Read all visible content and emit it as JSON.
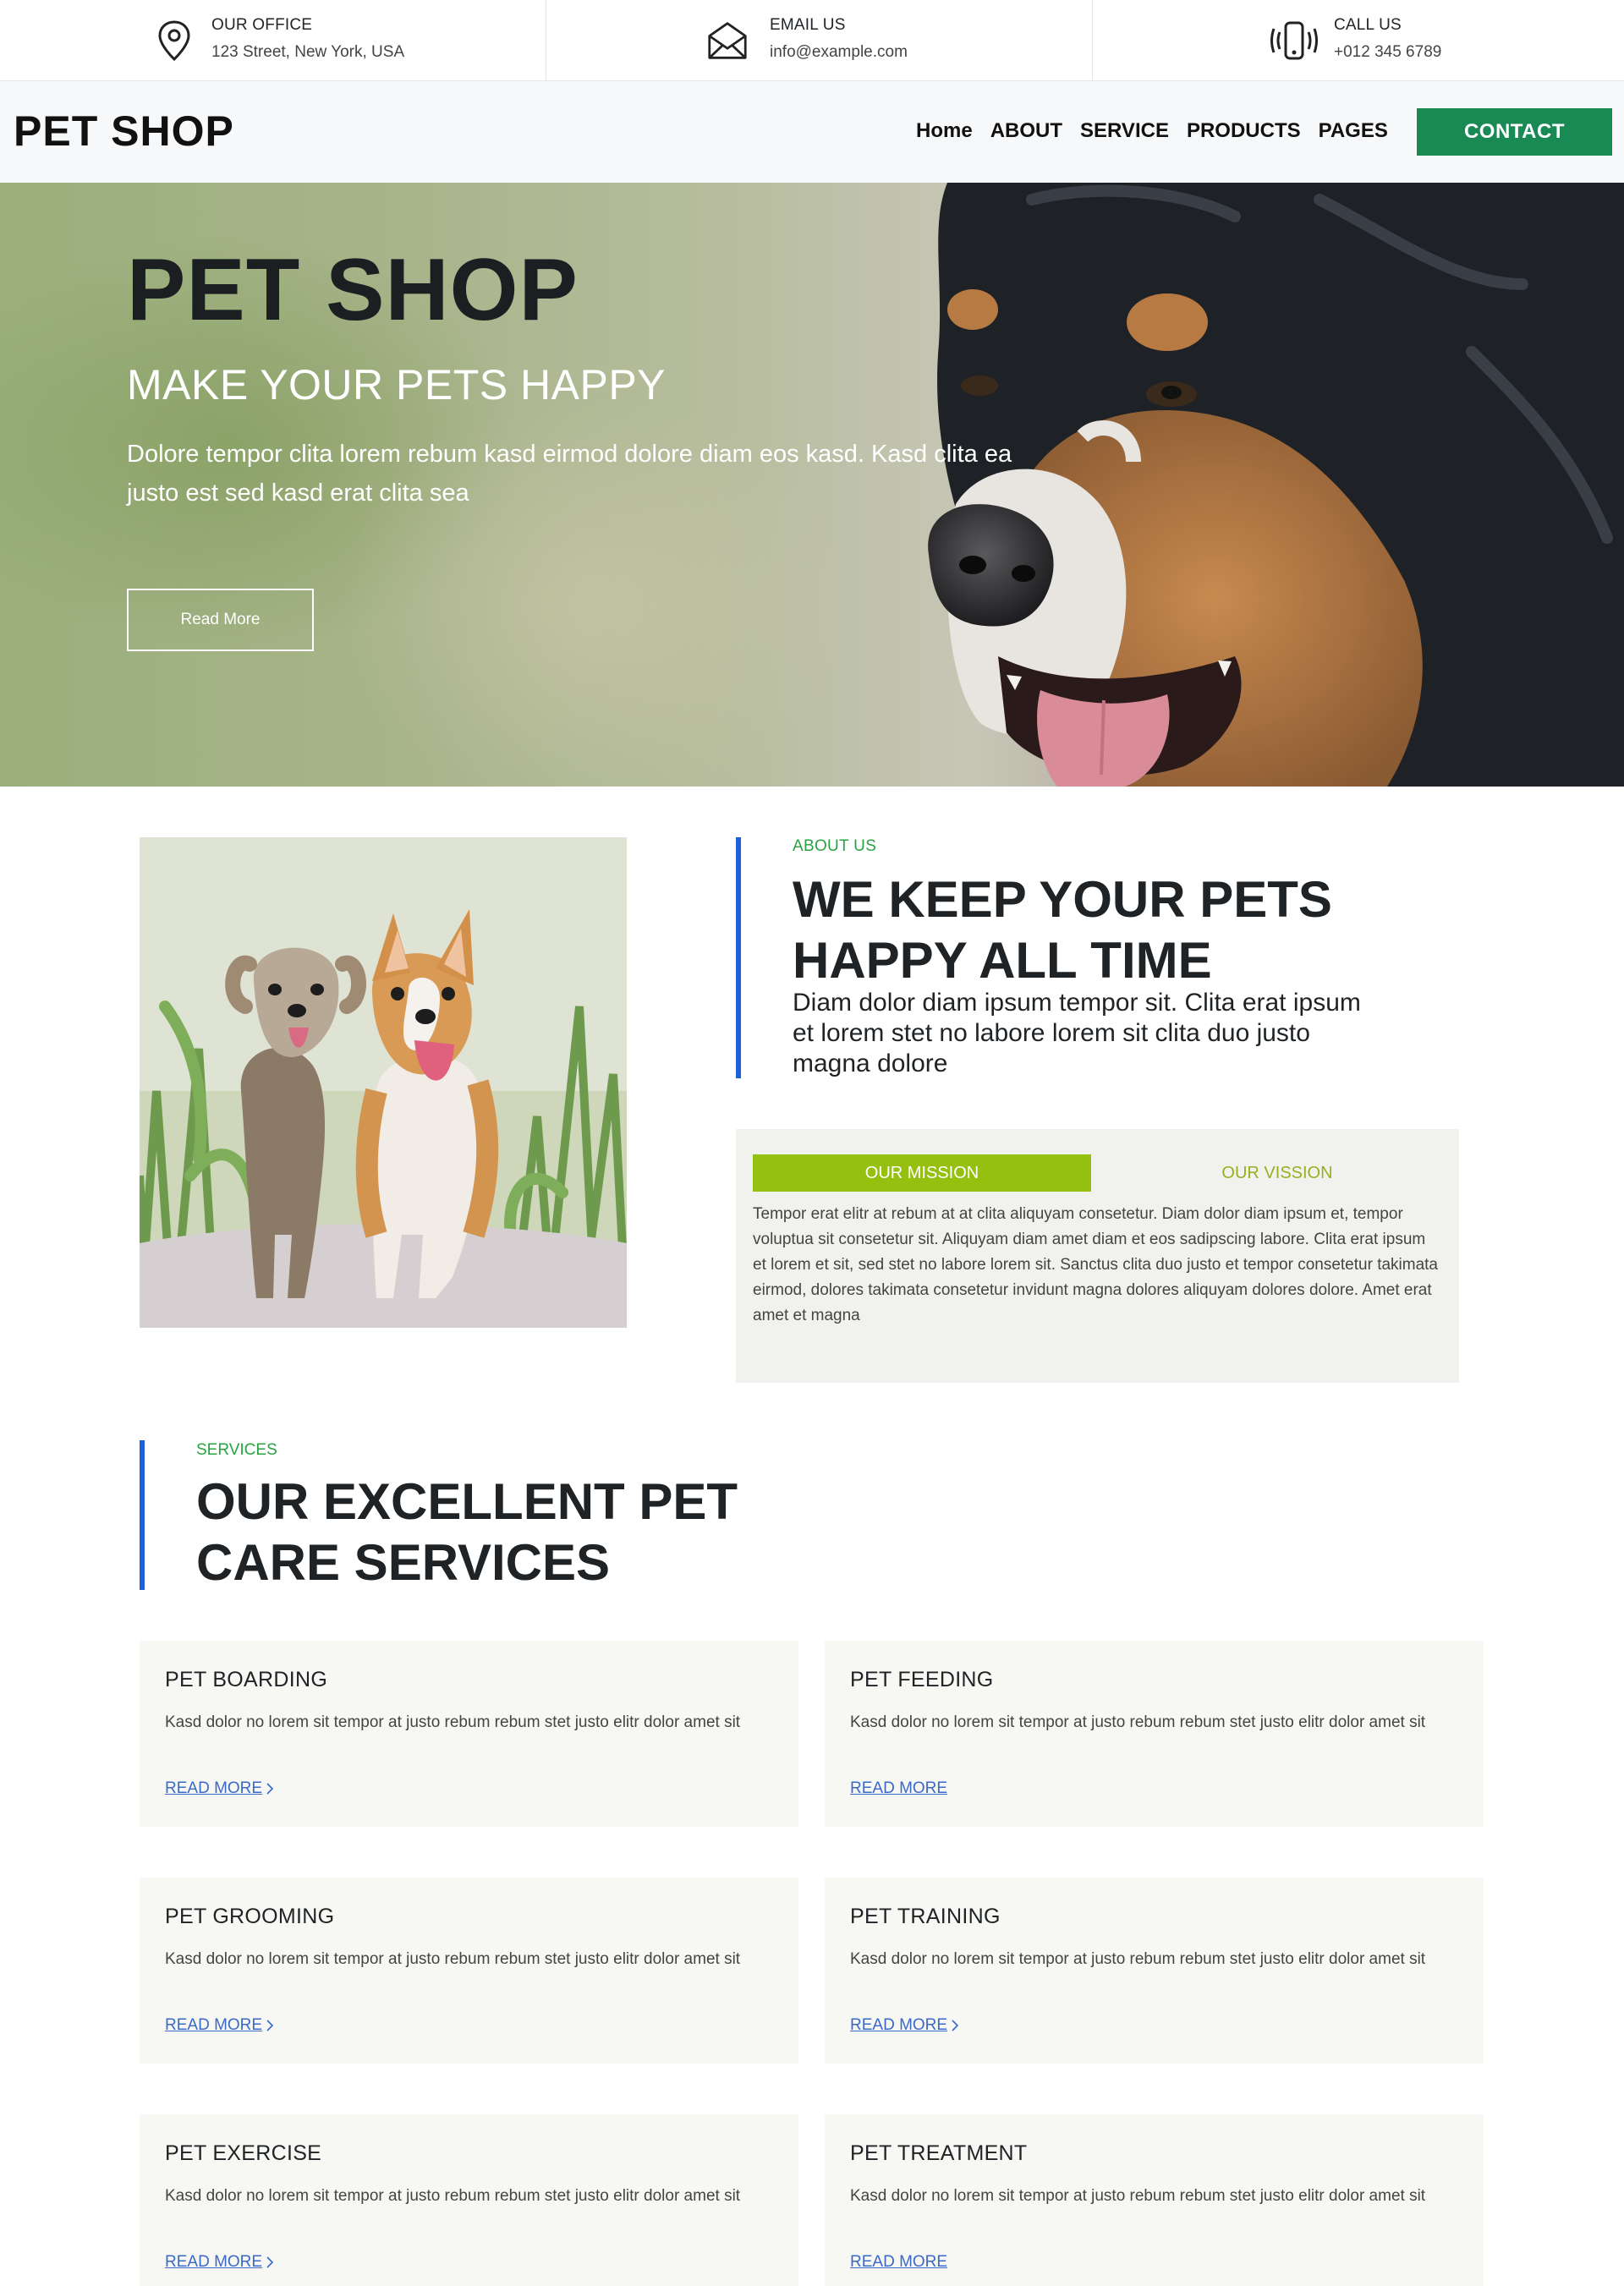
{
  "topbar": {
    "office": {
      "title": "OUR OFFICE",
      "value": "123 Street, New York, USA",
      "icon": "map-pin-icon"
    },
    "email": {
      "title": "EMAIL US",
      "value": "info@example.com",
      "icon": "envelope-icon"
    },
    "call": {
      "title": "CALL US",
      "value": "+012 345 6789",
      "icon": "phone-vibrate-icon"
    }
  },
  "navbar": {
    "brand": "PET SHOP",
    "items": [
      "Home",
      "ABOUT",
      "SERVICE",
      "PRODUCTS",
      "PAGES"
    ],
    "contact_label": "CONTACT"
  },
  "hero": {
    "title": "PET SHOP",
    "subtitle": "MAKE YOUR PETS HAPPY",
    "text": "Dolore tempor clita lorem rebum kasd eirmod dolore diam eos kasd. Kasd clita ea justo est sed kasd erat clita sea",
    "button_label": "Read More"
  },
  "about": {
    "kicker": "ABOUT US",
    "title": "WE KEEP YOUR PETS HAPPY ALL TIME",
    "lead": "Diam dolor diam ipsum tempor sit. Clita erat ipsum et lorem stet no labore lorem sit clita duo justo magna dolore",
    "tabs": [
      {
        "label": "OUR MISSION",
        "active": true
      },
      {
        "label": "OUR VISSION",
        "active": false
      }
    ],
    "tab_body": "Tempor erat elitr at rebum at at clita aliquyam consetetur. Diam dolor diam ipsum et, tempor voluptua sit consetetur sit. Aliquyam diam amet diam et eos sadipscing labore. Clita erat ipsum et lorem et sit, sed stet no labore lorem sit. Sanctus clita duo justo et tempor consetetur takimata eirmod, dolores takimata consetetur invidunt magna dolores aliquyam dolores dolore. Amet erat amet et magna"
  },
  "services": {
    "kicker": "SERVICES",
    "title": "OUR EXCELLENT PET CARE SERVICES",
    "items": [
      {
        "title": "PET BOARDING",
        "text": "Kasd dolor no lorem sit tempor at justo rebum rebum stet justo elitr dolor amet sit",
        "link": "READ MORE"
      },
      {
        "title": "PET FEEDING",
        "text": "Kasd dolor no lorem sit tempor at justo rebum rebum stet justo elitr dolor amet sit",
        "link": "READ MORE"
      },
      {
        "title": "PET GROOMING",
        "text": "Kasd dolor no lorem sit tempor at justo rebum rebum stet justo elitr dolor amet sit",
        "link": "READ MORE"
      },
      {
        "title": "PET TRAINING",
        "text": "Kasd dolor no lorem sit tempor at justo rebum rebum stet justo elitr dolor amet sit",
        "link": "READ MORE"
      },
      {
        "title": "PET EXERCISE",
        "text": "Kasd dolor no lorem sit tempor at justo rebum rebum stet justo elitr dolor amet sit",
        "link": "READ MORE"
      },
      {
        "title": "PET TREATMENT",
        "text": "Kasd dolor no lorem sit tempor at justo rebum rebum stet justo elitr dolor amet sit",
        "link": "READ MORE"
      }
    ]
  },
  "colors": {
    "accent_green": "#1a8a55",
    "tab_green": "#95c00f",
    "kicker_green": "#29a341",
    "bar_blue": "#1c62d6",
    "link_blue": "#3a69c8"
  }
}
